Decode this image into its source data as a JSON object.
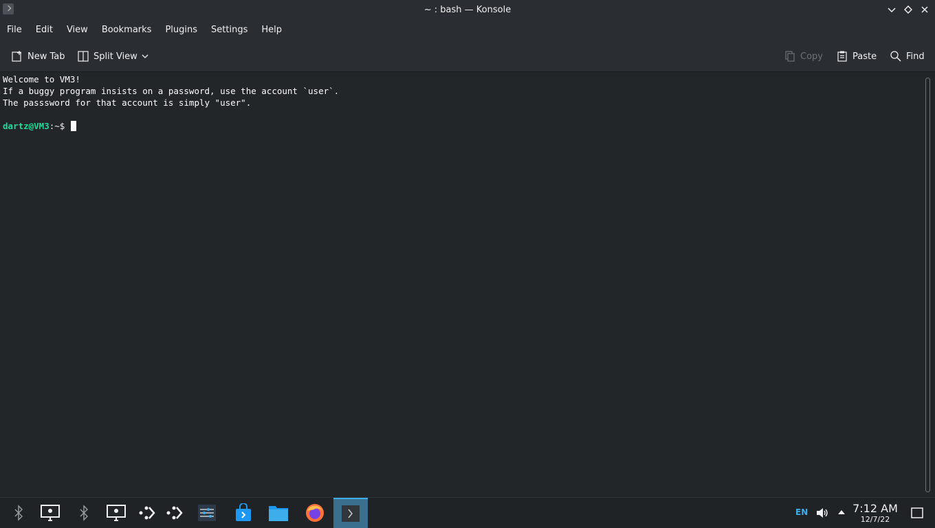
{
  "window": {
    "title": "~ : bash — Konsole"
  },
  "menu": {
    "items": [
      "File",
      "Edit",
      "View",
      "Bookmarks",
      "Plugins",
      "Settings",
      "Help"
    ]
  },
  "toolbar": {
    "new_tab": "New Tab",
    "split_view": "Split View",
    "copy": "Copy",
    "paste": "Paste",
    "find": "Find"
  },
  "terminal": {
    "lines": [
      "Welcome to VM3!",
      "If a buggy program insists on a password, use the account `user`.",
      "The passsword for that account is simply \"user\"."
    ],
    "prompt_user": "dartz@VM3",
    "prompt_path": ":~$ "
  },
  "taskbar": {
    "icons": [
      "bluetooth-icon",
      "display-icon",
      "bluetooth-icon",
      "display-icon",
      "kdeconnect-icon",
      "kdeconnect-icon",
      "system-settings-icon",
      "discover-store-icon",
      "file-manager-icon",
      "firefox-icon",
      "konsole-icon"
    ],
    "language": "EN",
    "time": "7:12 AM",
    "date": "12/7/22"
  },
  "colors": {
    "accent": "#3daee9",
    "prompt": "#1cdc9a",
    "background": "#232629"
  }
}
